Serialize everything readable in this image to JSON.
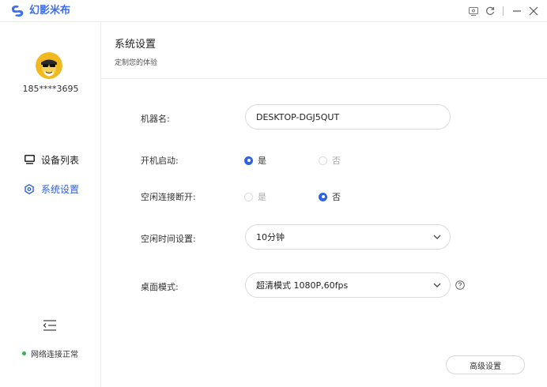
{
  "app": {
    "name": "幻影米布",
    "brand_color": "#3b6ef0",
    "controls": [
      "screen-cast-icon",
      "refresh-icon",
      "minimize-icon",
      "close-icon"
    ]
  },
  "sidebar": {
    "phone": "185****3695",
    "items": [
      {
        "label": "设备列表",
        "icon": "monitor-icon",
        "active": false
      },
      {
        "label": "系统设置",
        "icon": "settings-hex-icon",
        "active": true
      }
    ],
    "network_status": "网络连接正常",
    "network_color": "#38b24a"
  },
  "page": {
    "title": "系统设置",
    "subtitle": "定制您的体验"
  },
  "settings": {
    "machine_name": {
      "label": "机器名:",
      "value": "DESKTOP-DGJ5QUT"
    },
    "startup": {
      "label": "开机启动:",
      "yes": "是",
      "no": "否",
      "selected": "yes"
    },
    "idle_disconnect": {
      "label": "空闲连接断开:",
      "yes": "是",
      "no": "否",
      "selected": "no"
    },
    "idle_time": {
      "label": "空闲时间设置:",
      "value": "10分钟"
    },
    "desktop_mode": {
      "label": "桌面模式:",
      "value": "超清模式 1080P,60fps"
    }
  },
  "advanced_button": "高级设置",
  "accent_color": "#2f62e6"
}
